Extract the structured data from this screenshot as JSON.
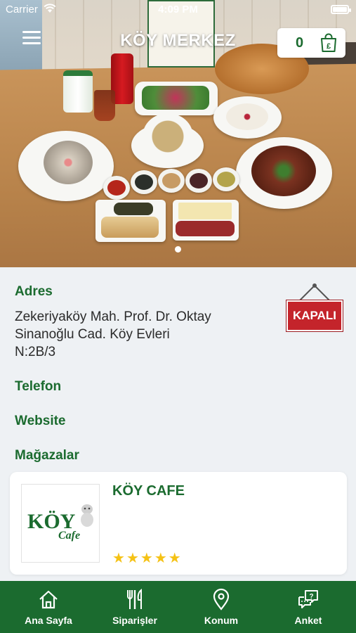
{
  "status_bar": {
    "carrier": "Carrier",
    "time": "4:09 PM"
  },
  "header": {
    "title": "KÖY MERKEZ",
    "cart_count": "0"
  },
  "hero": {
    "page_index": 1,
    "page_count": 1
  },
  "details": {
    "address_label": "Adres",
    "address_lines": [
      "Zekeriyaköy Mah. Prof. Dr. Oktay",
      "Sinanoğlu Cad. Köy Evleri",
      "N:2B/3"
    ],
    "closed_sign": "KAPALI",
    "phone_label": "Telefon",
    "website_label": "Website",
    "stores_label": "Mağazalar"
  },
  "stores": [
    {
      "name": "KÖY CAFE",
      "logo_main": "KÖY",
      "logo_sub": "Cafe",
      "rating": 5,
      "rating_max": 5
    }
  ],
  "tabs": [
    {
      "label": "Ana Sayfa",
      "icon": "home-icon"
    },
    {
      "label": "Siparişler",
      "icon": "cutlery-icon"
    },
    {
      "label": "Konum",
      "icon": "location-pin-icon"
    },
    {
      "label": "Anket",
      "icon": "survey-chat-icon"
    }
  ],
  "colors": {
    "brand": "#1b6b2f",
    "closed": "#c4242b",
    "star": "#f5c215"
  }
}
